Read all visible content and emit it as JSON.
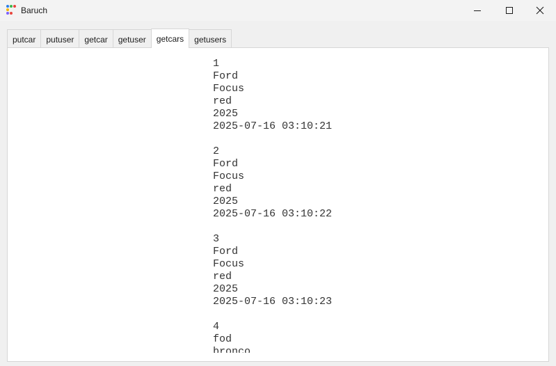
{
  "window": {
    "title": "Baruch",
    "icon_colors": [
      "#2b7de9",
      "#3cb54a",
      "#e8453c",
      "#f4b400",
      "#e8453c",
      "#7b61ff"
    ],
    "controls": [
      "minimize-icon",
      "maximize-icon",
      "close-icon"
    ]
  },
  "tabs": [
    {
      "label": "putcar",
      "active": false
    },
    {
      "label": "putuser",
      "active": false
    },
    {
      "label": "getcar",
      "active": false
    },
    {
      "label": "getuser",
      "active": false
    },
    {
      "label": "getcars",
      "active": true
    },
    {
      "label": "getusers",
      "active": false
    }
  ],
  "output": {
    "records": [
      {
        "id": "1",
        "make": "Ford",
        "model": "Focus",
        "color": "red",
        "year": "2025",
        "timestamp": "2025-07-16 03:10:21"
      },
      {
        "id": "2",
        "make": "Ford",
        "model": "Focus",
        "color": "red",
        "year": "2025",
        "timestamp": "2025-07-16 03:10:22"
      },
      {
        "id": "3",
        "make": "Ford",
        "model": "Focus",
        "color": "red",
        "year": "2025",
        "timestamp": "2025-07-16 03:10:23"
      },
      {
        "id": "4",
        "make": "fod",
        "model": "bronco",
        "color": "",
        "year": "",
        "timestamp": ""
      }
    ]
  }
}
